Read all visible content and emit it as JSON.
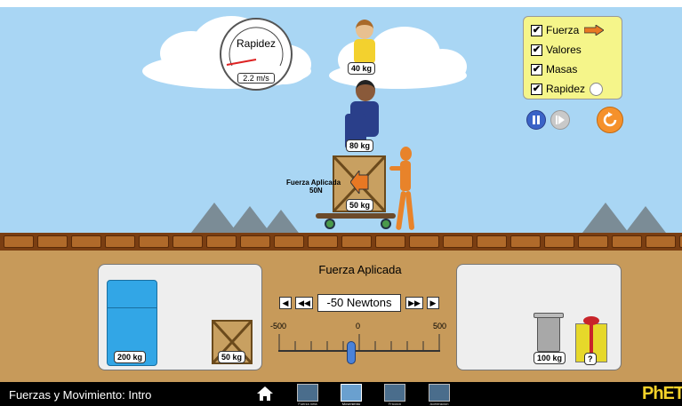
{
  "scene": {
    "speedometer": {
      "title": "Rapidez",
      "value": "2.2 m/s"
    },
    "applied_force": {
      "title": "Fuerza Aplicada",
      "value": "50N"
    },
    "masses": {
      "girl": "40 kg",
      "man": "80 kg",
      "crate": "50 kg"
    }
  },
  "options": {
    "items": [
      {
        "label": "Fuerza",
        "checked": true
      },
      {
        "label": "Valores",
        "checked": true
      },
      {
        "label": "Masas",
        "checked": true
      },
      {
        "label": "Rapidez",
        "checked": true
      }
    ]
  },
  "playback": {
    "pause": "pause",
    "step": "step",
    "reset": "reset"
  },
  "control": {
    "title": "Fuerza Aplicada",
    "value": "-50 Newtons",
    "force_value": -50,
    "slider_min_label": "-500",
    "slider_mid_label": "0",
    "slider_max_label": "500",
    "slider_min": -500,
    "slider_max": 500
  },
  "left_shelf": {
    "fridge": "200 kg",
    "crate": "50 kg"
  },
  "right_shelf": {
    "trash": "100 kg",
    "gift": "?"
  },
  "footer": {
    "title": "Fuerzas y Movimiento: Intro",
    "screens": [
      "Fuerza neta",
      "Movimiento",
      "Friccion",
      "Aceleracion"
    ],
    "logo": "PhET"
  },
  "colors": {
    "sky": "#a9d6f4",
    "ground": "#c79a5a",
    "reset": "#f5912b",
    "panel": "#f5f58a"
  }
}
